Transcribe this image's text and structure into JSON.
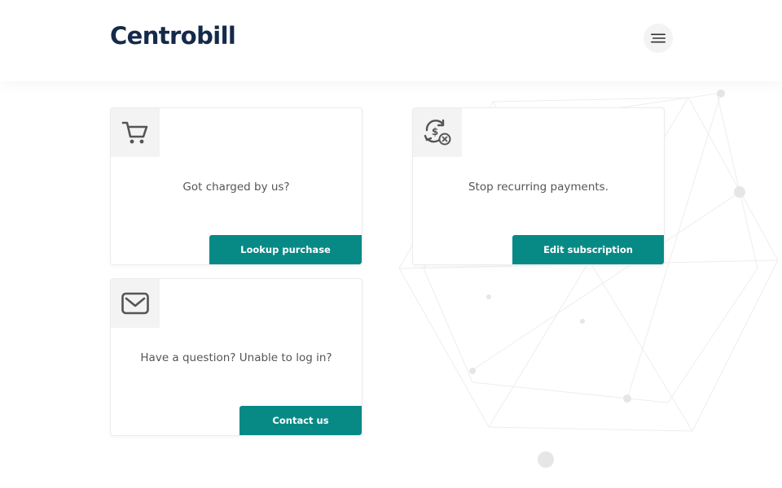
{
  "header": {
    "logo_text": "Centrobill"
  },
  "cards": [
    {
      "icon": "shopping-cart-icon",
      "text": "Got charged by us?",
      "button_label": "Lookup purchase"
    },
    {
      "icon": "recurring-payment-cancel-icon",
      "text": "Stop recurring payments.",
      "button_label": "Edit subscription"
    },
    {
      "icon": "envelope-icon",
      "text": "Have a question? Unable to log in?",
      "button_label": "Contact us"
    }
  ],
  "colors": {
    "brand_navy": "#152a4a",
    "accent_teal": "#078a86",
    "icon_gray": "#555555"
  }
}
